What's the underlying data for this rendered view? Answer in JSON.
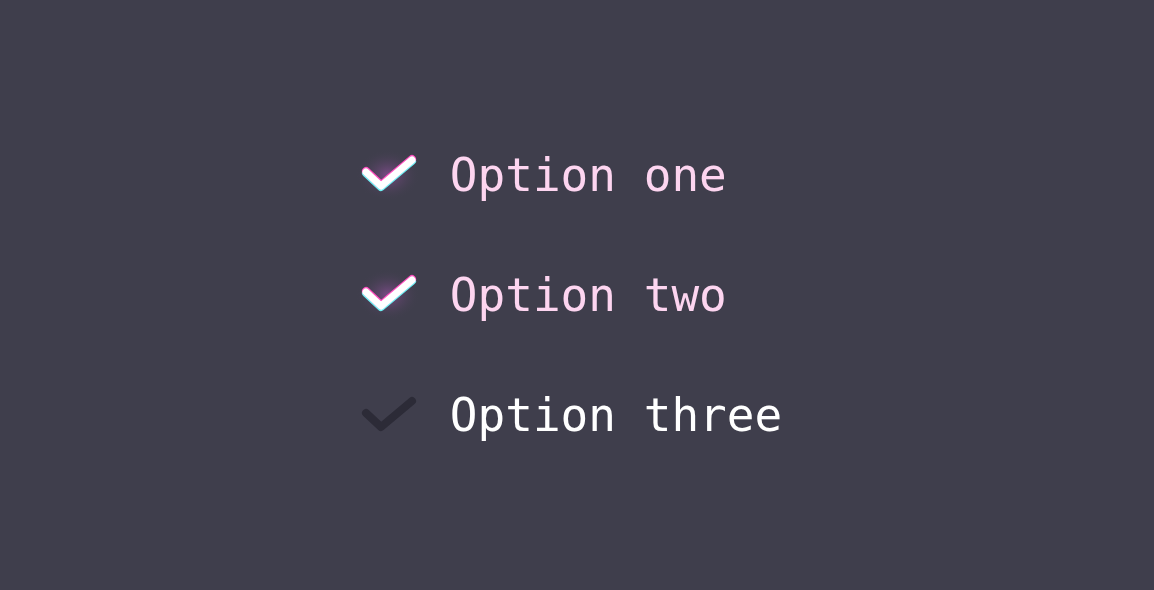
{
  "options": [
    {
      "label": "Option one",
      "checked": true
    },
    {
      "label": "Option two",
      "checked": true
    },
    {
      "label": "Option three",
      "checked": false
    }
  ]
}
